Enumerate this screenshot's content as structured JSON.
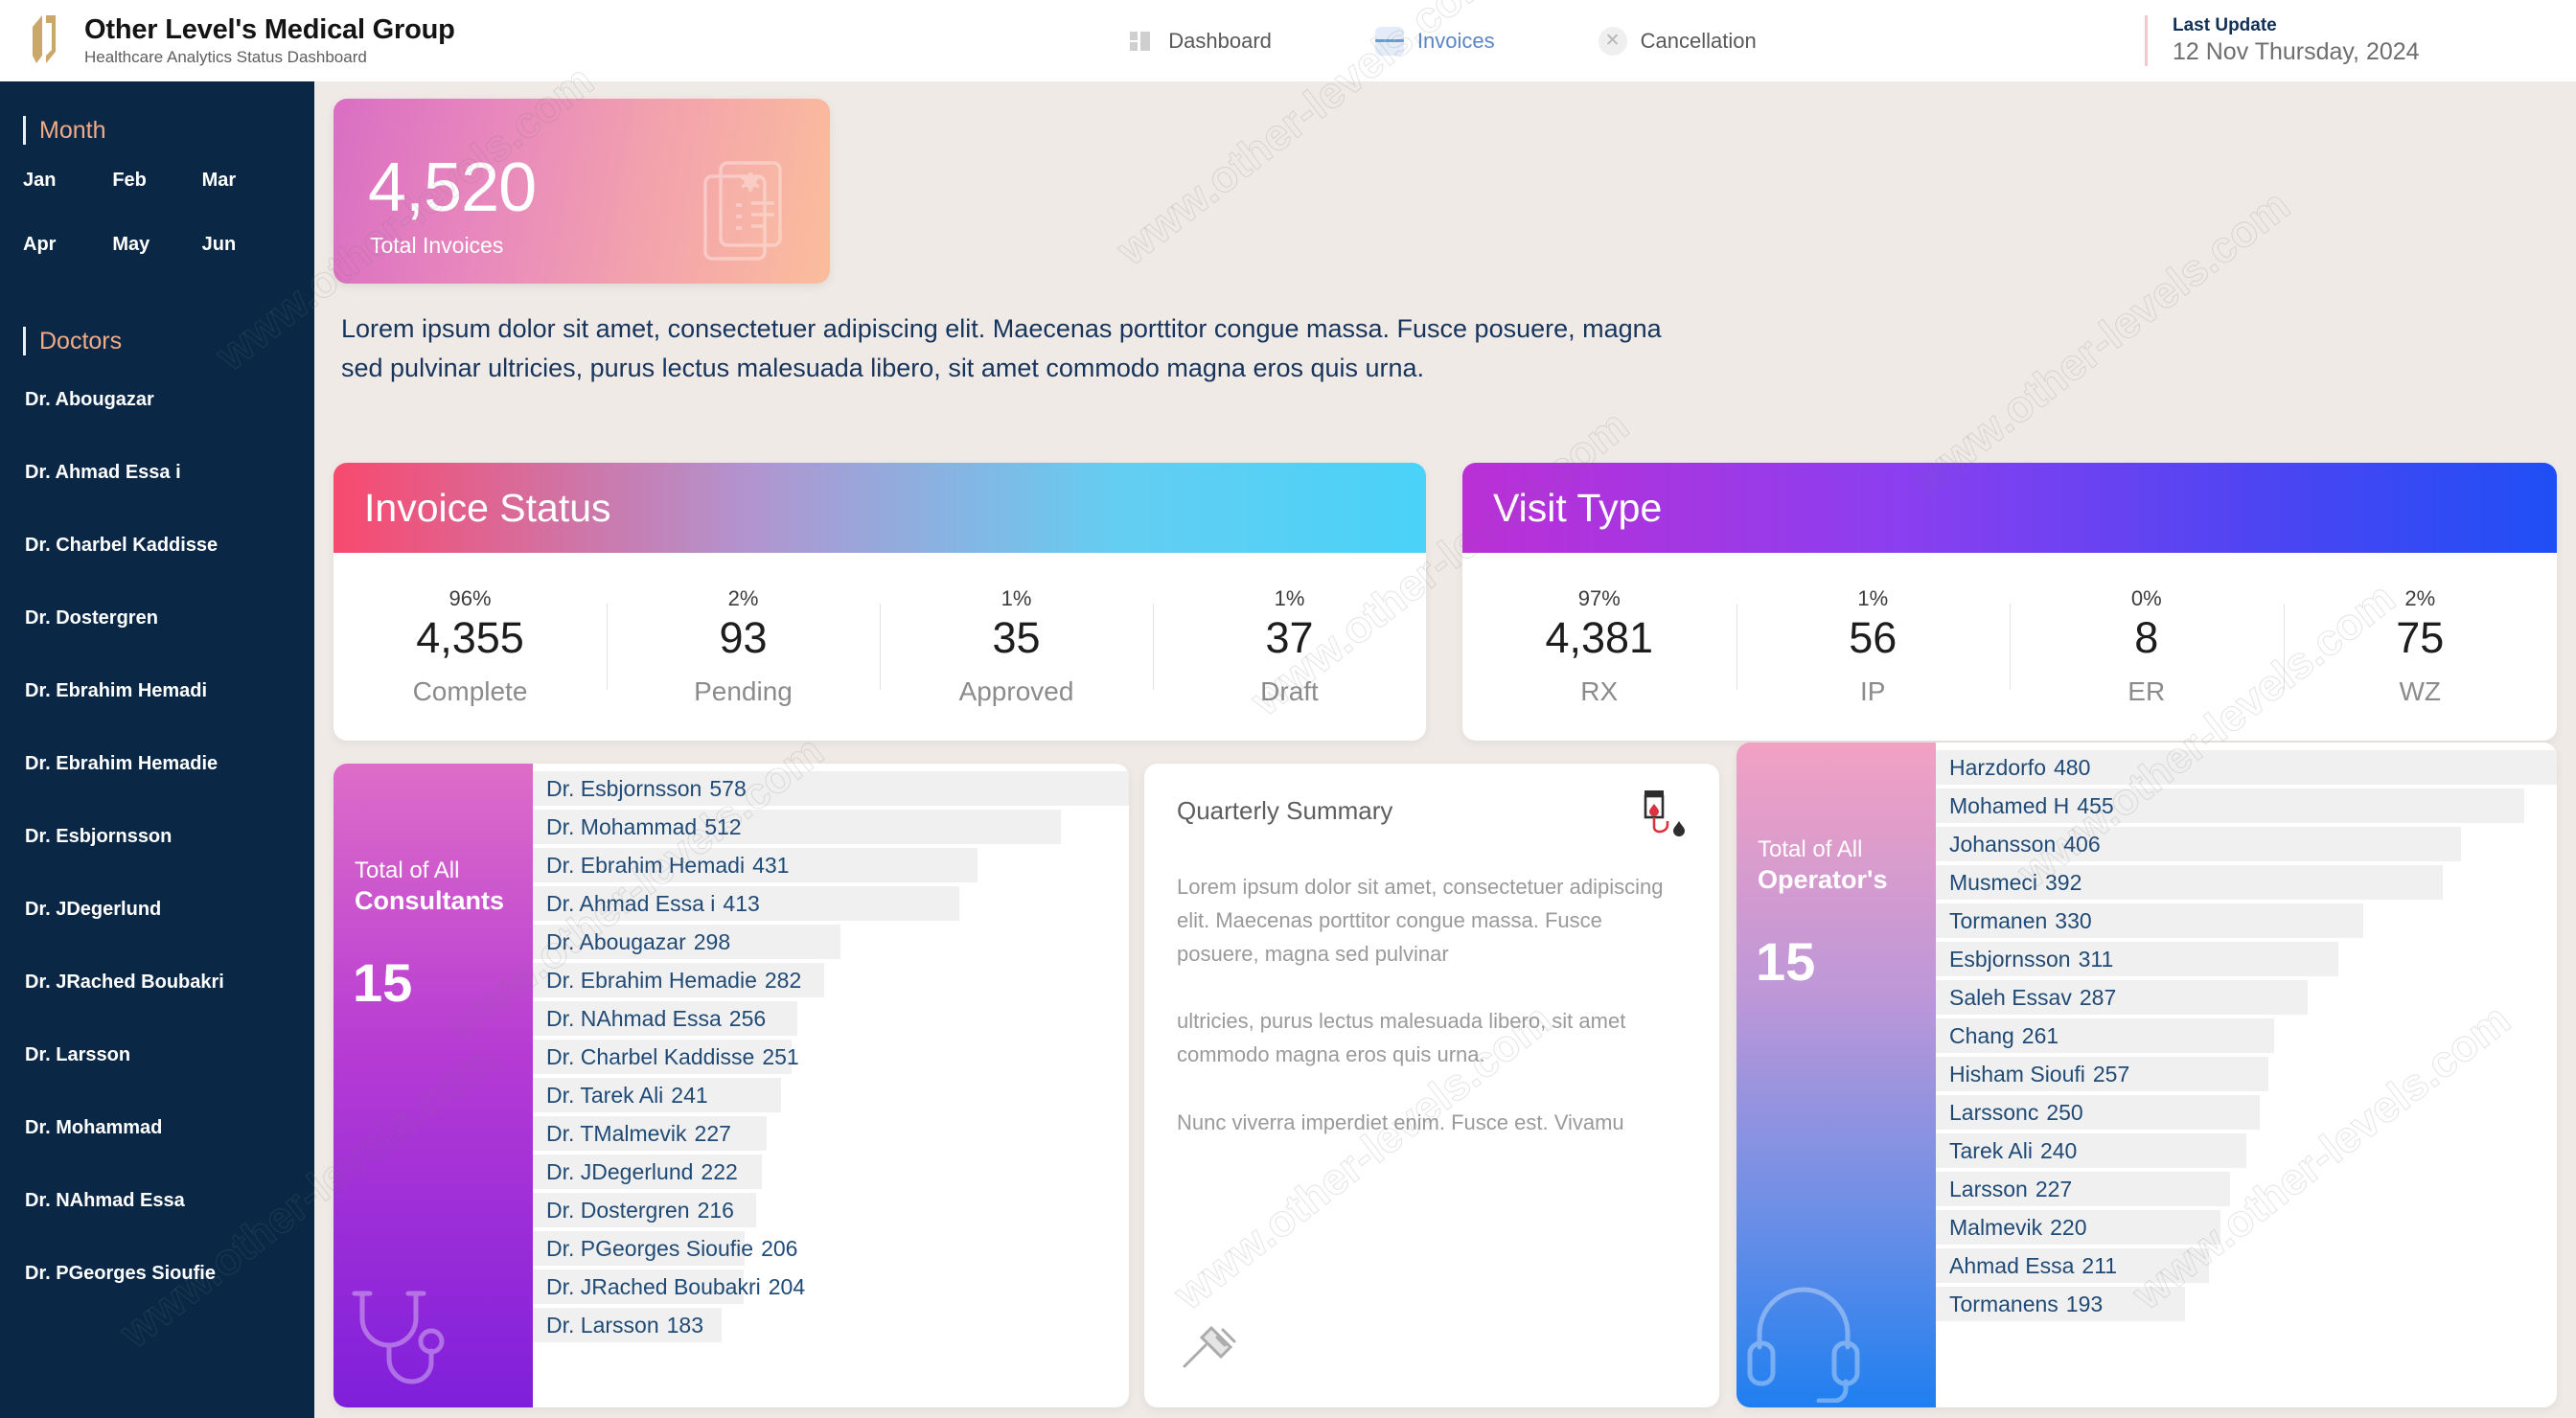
{
  "header": {
    "brand_title": "Other Level's Medical Group",
    "brand_subtitle": "Healthcare Analytics Status Dashboard",
    "logo_icon": "double-chevron-logo-icon",
    "nav": [
      {
        "label": "Dashboard",
        "icon": "grid-dashboard-icon",
        "active": false
      },
      {
        "label": "Invoices",
        "icon": "list-lines-icon",
        "active": true
      },
      {
        "label": "Cancellation",
        "icon": "close-circle-icon",
        "active": false
      }
    ],
    "last_update_title": "Last Update",
    "last_update_date": "12 Nov Thursday, 2024"
  },
  "sidebar": {
    "month_heading": "Month",
    "months": [
      "Jan",
      "Feb",
      "Mar",
      "Apr",
      "May",
      "Jun"
    ],
    "doctors_heading": "Doctors",
    "doctors": [
      "Dr. Abougazar",
      "Dr. Ahmad Essa i",
      "Dr. Charbel  Kaddisse",
      "Dr. Dostergren",
      "Dr. Ebrahim Hemadi",
      "Dr. Ebrahim Hemadie",
      "Dr. Esbjornsson",
      "Dr. JDegerlund",
      "Dr. JRached Boubakri",
      "Dr. Larsson",
      "Dr. Mohammad",
      "Dr. NAhmad Essa",
      "Dr. PGeorges Sioufie"
    ]
  },
  "kpi": {
    "value": "4,520",
    "label": "Total Invoices",
    "icon": "medical-invoice-icon"
  },
  "intro_text": "Lorem ipsum dolor sit amet, consectetuer adipiscing elit. Maecenas porttitor congue massa. Fusce posuere, magna sed pulvinar ultricies, purus lectus malesuada libero, sit amet commodo magna eros quis urna.",
  "invoice_status": {
    "title": "Invoice Status",
    "stats": [
      {
        "pct": "96%",
        "value": "4,355",
        "label": "Complete"
      },
      {
        "pct": "2%",
        "value": "93",
        "label": "Pending"
      },
      {
        "pct": "1%",
        "value": "35",
        "label": "Approved"
      },
      {
        "pct": "1%",
        "value": "37",
        "label": "Draft"
      }
    ]
  },
  "visit_type": {
    "title": "Visit Type",
    "stats": [
      {
        "pct": "97%",
        "value": "4,381",
        "label": "RX"
      },
      {
        "pct": "1%",
        "value": "56",
        "label": "IP"
      },
      {
        "pct": "0%",
        "value": "8",
        "label": "ER"
      },
      {
        "pct": "2%",
        "value": "75",
        "label": "WZ"
      }
    ]
  },
  "consultants": {
    "side_line1": "Total of All",
    "side_line2": "Consultants",
    "total": "15",
    "side_icon": "stethoscope-icon"
  },
  "operators": {
    "side_line1": "Total of All",
    "side_line2": "Operator's",
    "total": "15",
    "side_icon": "headset-icon"
  },
  "quarterly": {
    "title": "Quarterly Summary",
    "icon": "iv-blood-drip-icon",
    "footer_icon": "syringe-icon",
    "paragraphs": [
      "Lorem ipsum dolor sit amet, consectetuer adipiscing elit. Maecenas porttitor congue massa. Fusce posuere, magna sed pulvinar",
      "ultricies, purus lectus malesuada libero, sit amet commodo magna eros quis urna.",
      "Nunc viverra imperdiet enim. Fusce est. Vivamu"
    ]
  },
  "colors": {
    "sidebar_bg": "#0a2845",
    "page_bg": "#efeae6",
    "accent_orange": "#f3ab86",
    "accent_blue": "#5b86c4",
    "text_navy": "#1f4a76"
  },
  "watermarks": [
    "www.other-levels.com",
    "www.other-levels.com",
    "www.other-levels.com",
    "www.other-levels.com",
    "www.other-levels.com",
    "www.other-levels.com",
    "www.other-levels.com",
    "www.other-levels.com",
    "www.other-levels.com"
  ],
  "chart_data": [
    {
      "type": "bar",
      "title": "Total of All Consultants",
      "orientation": "horizontal",
      "xlabel": "",
      "ylabel": "",
      "max_value": 578,
      "categories": [
        "Dr. Esbjornsson",
        "Dr. Mohammad",
        "Dr. Ebrahim Hemadi",
        "Dr. Ahmad Essa i",
        "Dr. Abougazar",
        "Dr. Ebrahim Hemadie",
        "Dr. NAhmad Essa",
        "Dr. Charbel Kaddisse",
        "Dr. Tarek Ali",
        "Dr. TMalmevik",
        "Dr. JDegerlund",
        "Dr. Dostergren",
        "Dr. PGeorges Sioufie",
        "Dr. JRached Boubakri",
        "Dr. Larsson"
      ],
      "values": [
        578,
        512,
        431,
        413,
        298,
        282,
        256,
        251,
        241,
        227,
        222,
        216,
        206,
        204,
        183
      ]
    },
    {
      "type": "bar",
      "title": "Total of All Operator's",
      "orientation": "horizontal",
      "xlabel": "",
      "ylabel": "",
      "max_value": 480,
      "categories": [
        "Harzdorfo",
        "Mohamed H",
        "Johansson",
        "Musmeci",
        "Tormanen",
        "Esbjornsson",
        "Saleh Essav",
        "Chang",
        "Hisham Sioufi",
        "Larssonc",
        "Tarek Ali",
        "Larsson",
        "Malmevik",
        "Ahmad Essa",
        "Tormanens"
      ],
      "values": [
        480,
        455,
        406,
        392,
        330,
        311,
        287,
        261,
        257,
        250,
        240,
        227,
        220,
        211,
        193
      ]
    },
    {
      "type": "table",
      "title": "Invoice Status",
      "categories": [
        "Complete",
        "Pending",
        "Approved",
        "Draft"
      ],
      "values": [
        4355,
        93,
        35,
        37
      ],
      "percentages": [
        "96%",
        "2%",
        "1%",
        "1%"
      ]
    },
    {
      "type": "table",
      "title": "Visit Type",
      "categories": [
        "RX",
        "IP",
        "ER",
        "WZ"
      ],
      "values": [
        4381,
        56,
        8,
        75
      ],
      "percentages": [
        "97%",
        "1%",
        "0%",
        "2%"
      ]
    }
  ]
}
